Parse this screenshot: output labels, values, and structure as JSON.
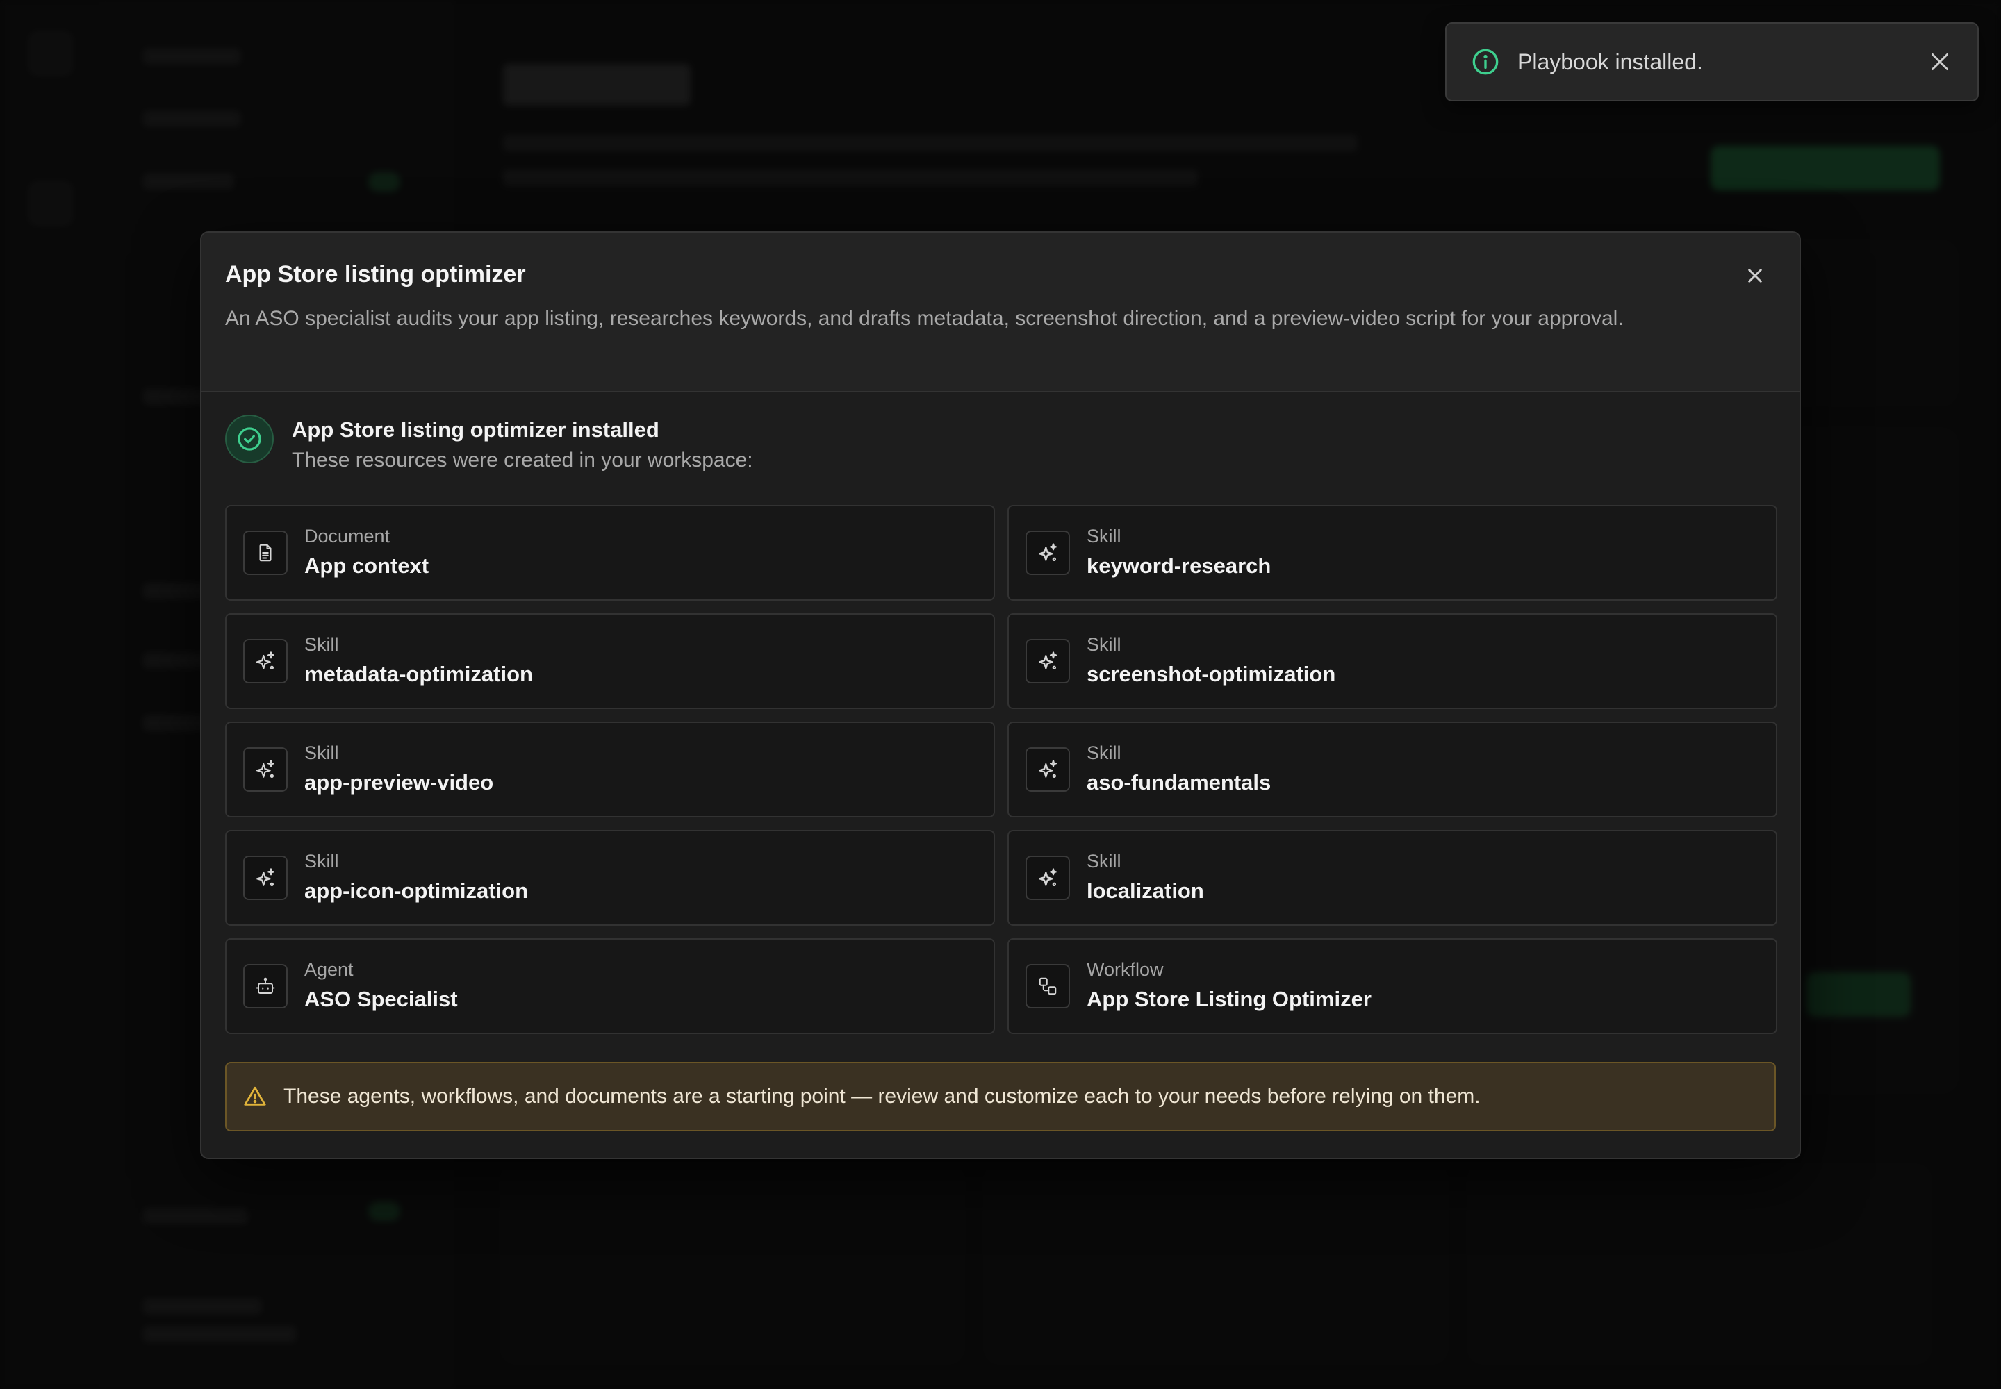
{
  "toast": {
    "message": "Playbook installed.",
    "icon": "info-icon",
    "close_icon": "close-icon"
  },
  "modal": {
    "title": "App Store listing optimizer",
    "description": "An ASO specialist audits your app listing, researches keywords, and drafts metadata, screenshot direction, and a preview-video script for your approval.",
    "close_icon": "close-icon",
    "success": {
      "title": "App Store listing optimizer installed",
      "subtitle": "These resources were created in your workspace:",
      "icon": "check-circle-icon",
      "accent": "#3ecf8e"
    },
    "resources": [
      {
        "type": "Document",
        "name": "App context",
        "icon": "document-icon"
      },
      {
        "type": "Skill",
        "name": "keyword-research",
        "icon": "sparkles-icon"
      },
      {
        "type": "Skill",
        "name": "metadata-optimization",
        "icon": "sparkles-icon"
      },
      {
        "type": "Skill",
        "name": "screenshot-optimization",
        "icon": "sparkles-icon"
      },
      {
        "type": "Skill",
        "name": "app-preview-video",
        "icon": "sparkles-icon"
      },
      {
        "type": "Skill",
        "name": "aso-fundamentals",
        "icon": "sparkles-icon"
      },
      {
        "type": "Skill",
        "name": "app-icon-optimization",
        "icon": "sparkles-icon"
      },
      {
        "type": "Skill",
        "name": "localization",
        "icon": "sparkles-icon"
      },
      {
        "type": "Agent",
        "name": "ASO Specialist",
        "icon": "robot-icon"
      },
      {
        "type": "Workflow",
        "name": "App Store Listing Optimizer",
        "icon": "workflow-icon"
      }
    ],
    "warning": {
      "text": "These agents, workflows, and documents are a starting point — review and customize each to your needs before relying on them.",
      "icon": "warning-icon",
      "color": "#e0b33a"
    }
  }
}
